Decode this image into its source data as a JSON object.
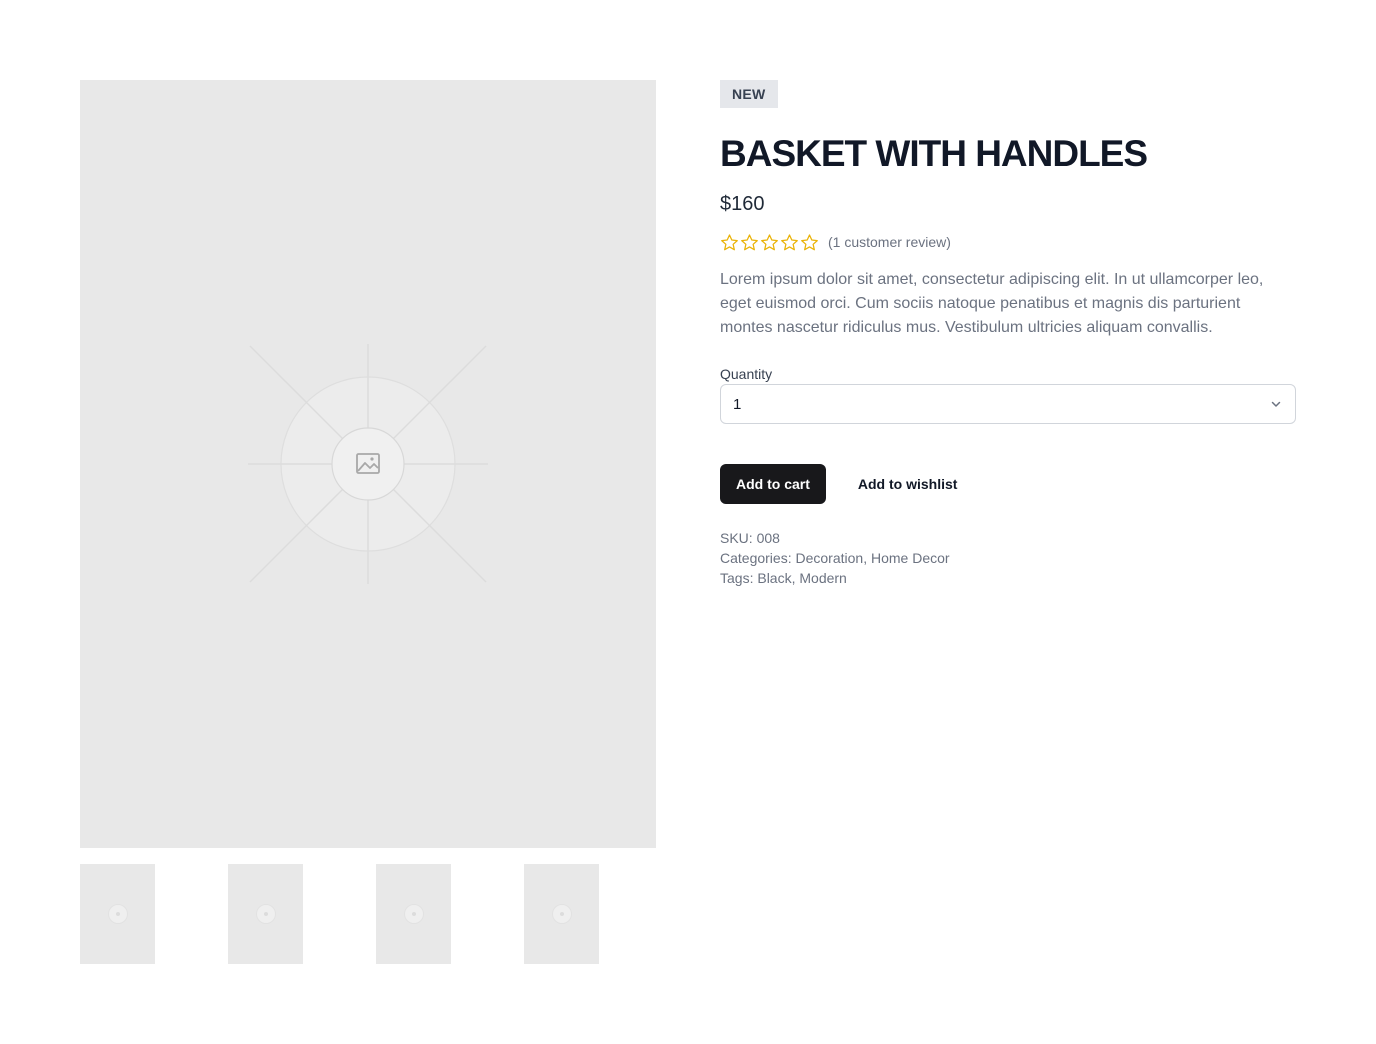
{
  "product": {
    "badge": "NEW",
    "title": "BASKET WITH HANDLES",
    "price": "$160",
    "rating": {
      "stars_filled": 0,
      "stars_total": 5,
      "review_text": "(1 customer review)",
      "star_color": "#eab308"
    },
    "description": "Lorem ipsum dolor sit amet, consectetur adipiscing elit. In ut ullamcorper leo, eget euismod orci. Cum sociis natoque penatibus et magnis dis parturient montes nascetur ridiculus mus. Vestibulum ultricies aliquam convallis."
  },
  "quantity": {
    "label": "Quantity",
    "selected": "1",
    "icon": "chevron-down-icon"
  },
  "actions": {
    "add_to_cart": "Add to cart",
    "add_to_wishlist": "Add to wishlist"
  },
  "meta": {
    "sku_label": "SKU:",
    "sku_value": "008",
    "categories_label": "Categories:",
    "categories": [
      "Decoration",
      "Home Decor"
    ],
    "tags_label": "Tags:",
    "tags": [
      "Black",
      "Modern"
    ]
  },
  "gallery": {
    "main_icon": "image-placeholder-icon",
    "thumbnail_count": 4
  }
}
